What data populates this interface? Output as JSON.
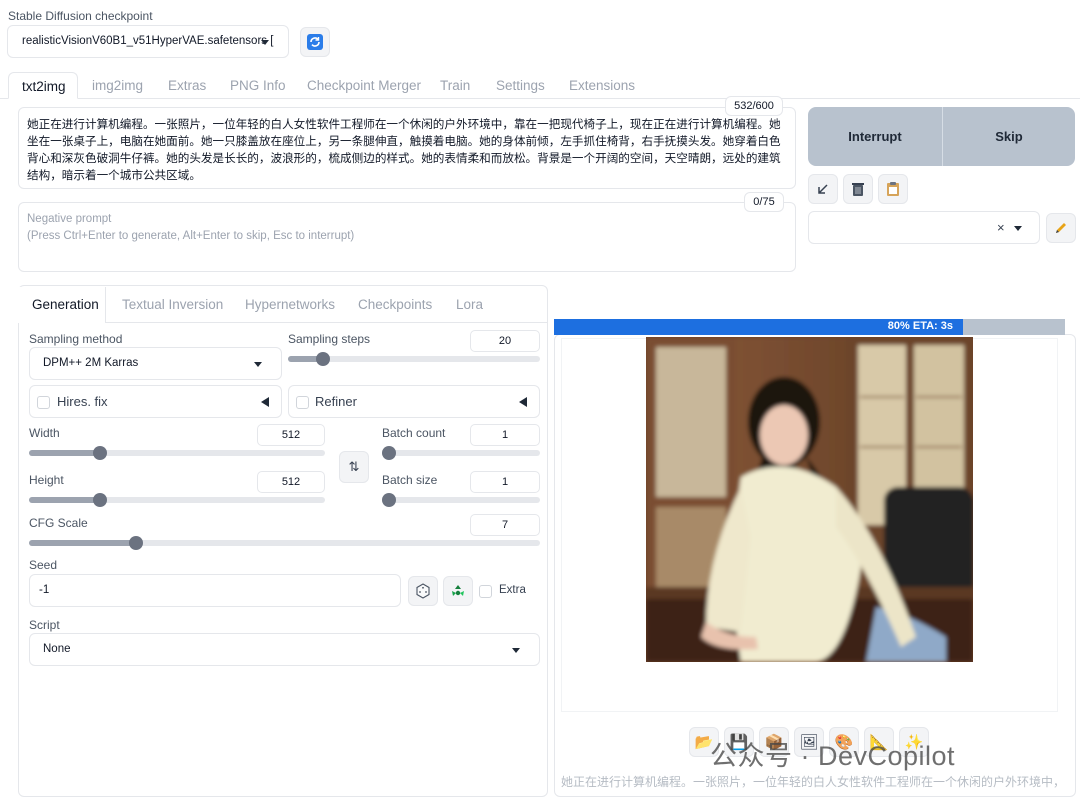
{
  "checkpoint": {
    "label": "Stable Diffusion checkpoint",
    "value": "realisticVisionV60B1_v51HyperVAE.safetensors ["
  },
  "main_tabs": [
    "txt2img",
    "img2img",
    "Extras",
    "PNG Info",
    "Checkpoint Merger",
    "Train",
    "Settings",
    "Extensions"
  ],
  "prompt": {
    "text": "她正在进行计算机编程。一张照片，一位年轻的白人女性软件工程师在一个休闲的户外环境中，靠在一把现代椅子上，现在正在进行计算机编程。她坐在一张桌子上，电脑在她面前。她一只膝盖放在座位上，另一条腿伸直，触摸着电脑。她的身体前倾，左手抓住椅背，右手抚摸头发。她穿着白色背心和深灰色破洞牛仔裤。她的头发是长长的，波浪形的，梳成侧边的样式。她的表情柔和而放松。背景是一个开阔的空间，天空晴朗，远处的建筑结构，暗示着一个城市公共区域。",
    "counter": "532/600"
  },
  "negative_prompt": {
    "placeholder_line1": "Negative prompt",
    "placeholder_line2": "(Press Ctrl+Enter to generate, Alt+Enter to skip, Esc to interrupt)",
    "counter": "0/75"
  },
  "actions": {
    "interrupt": "Interrupt",
    "skip": "Skip"
  },
  "sub_tabs": [
    "Generation",
    "Textual Inversion",
    "Hypernetworks",
    "Checkpoints",
    "Lora"
  ],
  "sampling_method": {
    "label": "Sampling method",
    "value": "DPM++ 2M Karras"
  },
  "sampling_steps": {
    "label": "Sampling steps",
    "value": "20",
    "fraction": 0.14
  },
  "hires_fix": {
    "label": "Hires. fix"
  },
  "refiner": {
    "label": "Refiner"
  },
  "width": {
    "label": "Width",
    "value": "512",
    "fraction": 0.24
  },
  "height": {
    "label": "Height",
    "value": "512",
    "fraction": 0.24
  },
  "batch_count": {
    "label": "Batch count",
    "value": "1",
    "fraction": 0.0
  },
  "batch_size": {
    "label": "Batch size",
    "value": "1",
    "fraction": 0.0
  },
  "cfg_scale": {
    "label": "CFG Scale",
    "value": "7",
    "fraction": 0.21
  },
  "seed": {
    "label": "Seed",
    "value": "-1",
    "extra_label": "Extra"
  },
  "script": {
    "label": "Script",
    "value": "None"
  },
  "progress": {
    "text": "80% ETA: 3s",
    "fraction": 0.8
  },
  "output_caption": "她正在进行计算机编程。一张照片，一位年轻的白人女性软件工程师在一个休闲的户外环境中，",
  "watermark": "公众号 · DevCopilot",
  "colors": {
    "accent": "#1d6fe0",
    "action_buttons": "#b8c2ce",
    "tab_active_border": "#e5e7eb"
  }
}
